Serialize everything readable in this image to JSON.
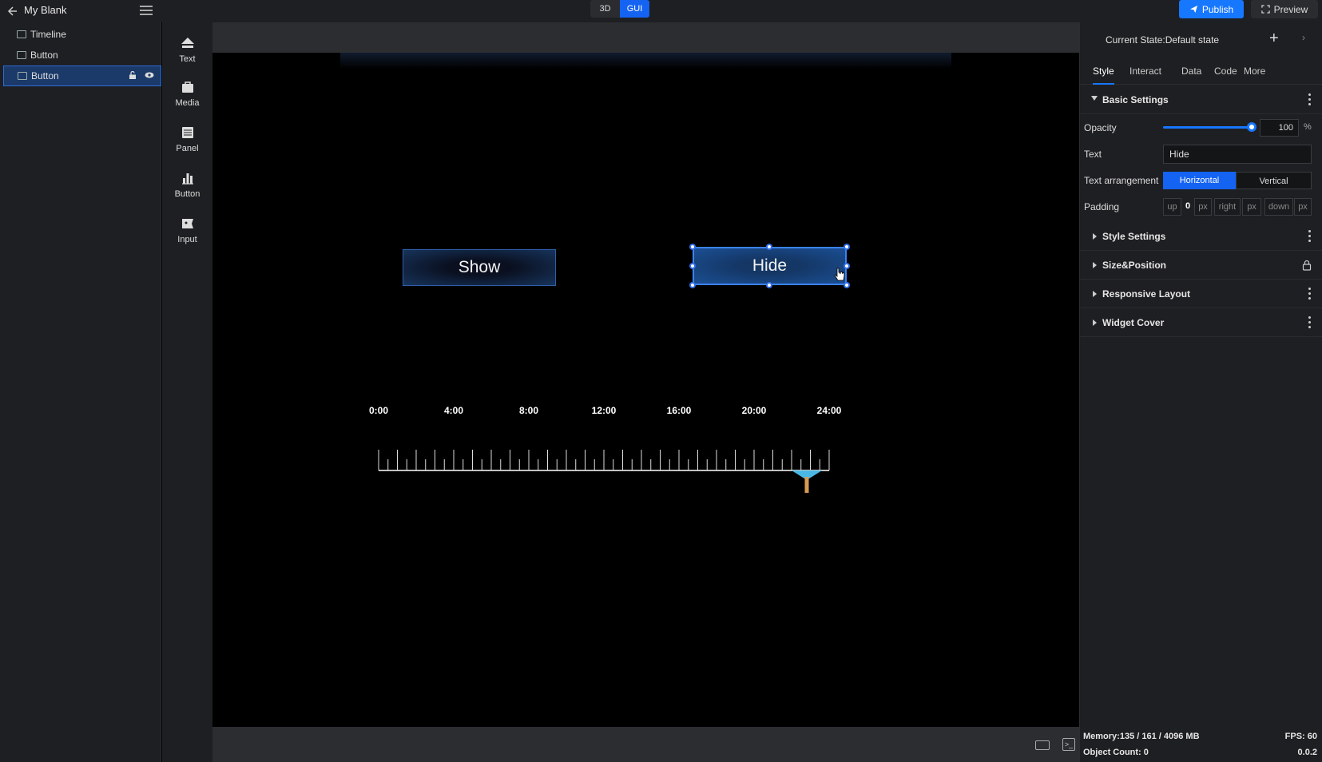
{
  "header": {
    "project_name": "My Blank",
    "modes": [
      "3D",
      "GUI"
    ],
    "active_mode": "GUI",
    "publish_label": "Publish",
    "preview_label": "Preview"
  },
  "layers": {
    "items": [
      {
        "label": "Timeline",
        "selected": false
      },
      {
        "label": "Button",
        "selected": false
      },
      {
        "label": "Button",
        "selected": true
      }
    ]
  },
  "toolbar": {
    "tools": [
      {
        "label": "Text",
        "icon": "text-widget-icon"
      },
      {
        "label": "Media",
        "icon": "media-widget-icon"
      },
      {
        "label": "Panel",
        "icon": "panel-widget-icon"
      },
      {
        "label": "Button",
        "icon": "chart-widget-icon"
      },
      {
        "label": "Input",
        "icon": "input-widget-icon"
      }
    ]
  },
  "canvas": {
    "show_button": "Show",
    "hide_button": "Hide",
    "timeline_labels": [
      "0:00",
      "4:00",
      "8:00",
      "12:00",
      "16:00",
      "20:00",
      "24:00"
    ],
    "marker_accent": "#4ab8e6",
    "marker_stem": "#d69a55"
  },
  "properties": {
    "current_state": "Current State:Default state",
    "tabs": [
      "Style",
      "Interact",
      "Data",
      "Code",
      "More"
    ],
    "active_tab": "Style",
    "basic_settings": {
      "title": "Basic Settings",
      "opacity_label": "Opacity",
      "opacity_value": "100",
      "opacity_unit": "%",
      "text_label": "Text",
      "text_value": "Hide",
      "arrangement_label": "Text arrangement",
      "arrangement_options": [
        "Horizontal",
        "Vertical"
      ],
      "arrangement_selected": "Horizontal",
      "padding_label": "Padding",
      "padding_up_label": "up",
      "padding_up_value": "0",
      "padding_unit": "px",
      "padding_right_label": "right",
      "padding_right_unit": "px",
      "padding_down_label": "down",
      "padding_down_unit": "px"
    },
    "sections": [
      "Style Settings",
      "Size&Position",
      "Responsive Layout",
      "Widget Cover"
    ]
  },
  "status": {
    "memory": "Memory:135 / 161 / 4096 MB",
    "fps": "FPS: 60",
    "object_count": "Object Count: 0",
    "version": "0.0.2"
  },
  "colors": {
    "accent": "#1677ff",
    "panel_bg": "#1e1f22",
    "selection": "#1b3a69"
  }
}
